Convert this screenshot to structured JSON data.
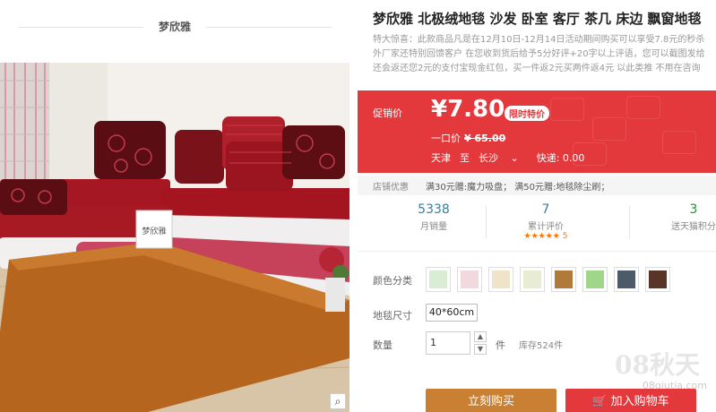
{
  "brand": {
    "name": "梦欣雅"
  },
  "image": {
    "sofa_tag_text": "梦欣雅"
  },
  "product": {
    "title": "梦欣雅 北极绒地毯 沙发 卧室 客厅 茶几 床边 飘窗地毯",
    "promo_lines": [
      "特大惊喜：此款商品凡是在12月10日-12月14日活动期间购买可以享受7.8元的秒杀",
      "外厂家还特别回馈客户 在您收到货后给予5分好评+20字以上评语，您可以截图发给",
      "还会返还您2元的支付宝现金红包，买一件返2元买两件返4元 以此类推 不用在咨询"
    ]
  },
  "price": {
    "label": "促销价",
    "value": "¥7.80",
    "badge": "限时特价",
    "original_label": "一口价",
    "original_value": "¥ 65.00",
    "ship_from": "天津",
    "ship_to_word": "至",
    "ship_dest": "长沙",
    "express": "快递: 0.00"
  },
  "shop": {
    "label": "店铺优惠",
    "text": "满30元赠:魔力吸盘； 满50元赠:地毯除尘刷；"
  },
  "stats": [
    {
      "num": "5338",
      "cap": "月销量"
    },
    {
      "num": "7",
      "cap": "累计评价",
      "stars": "★★★★★ 5"
    },
    {
      "num": "3",
      "cap": "送天猫积分"
    }
  ],
  "color_label": "颜色分类",
  "colors": [
    "#d9ecd4",
    "#f2d9de",
    "#efe4c8",
    "#e8ecd2",
    "#b07a3a",
    "#9fd68a",
    "#4d5a6a",
    "#5a3426"
  ],
  "size_label": "地毯尺寸",
  "size_option": "40*60cm",
  "qty_label": "数量",
  "qty_value": "1",
  "qty_unit": "件",
  "stock": "库存524件",
  "buttons": {
    "buy": "立刻购买",
    "cart": "加入购物车"
  },
  "icons": {
    "zoom": "magnifier-icon",
    "up": "arrow-up-icon",
    "down": "arrow-down-icon",
    "cart": "cart-icon"
  },
  "watermark": {
    "main": "08秋天",
    "sub": "08qiutia.com"
  }
}
